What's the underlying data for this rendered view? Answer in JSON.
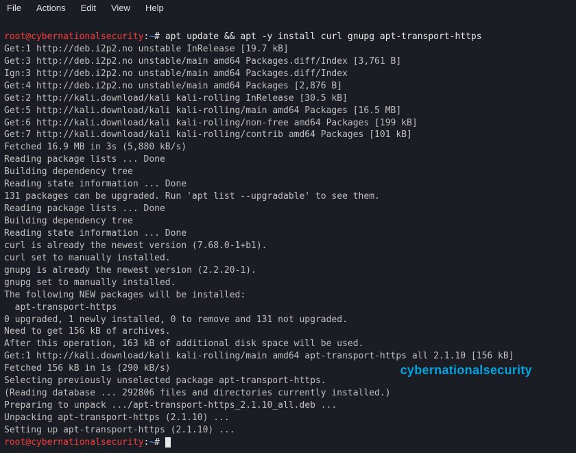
{
  "menubar": {
    "file": "File",
    "actions": "Actions",
    "edit": "Edit",
    "view": "View",
    "help": "Help"
  },
  "prompt": {
    "user_host": "root@cybernationalsecurity",
    "sep": ":",
    "path": "~",
    "symbol": "#"
  },
  "command": "apt update && apt -y install curl gnupg apt-transport-https",
  "output": [
    "Get:1 http://deb.i2p2.no unstable InRelease [19.7 kB]",
    "Get:3 http://deb.i2p2.no unstable/main amd64 Packages.diff/Index [3,761 B]",
    "Ign:3 http://deb.i2p2.no unstable/main amd64 Packages.diff/Index",
    "Get:4 http://deb.i2p2.no unstable/main amd64 Packages [2,876 B]",
    "Get:2 http://kali.download/kali kali-rolling InRelease [30.5 kB]",
    "Get:5 http://kali.download/kali kali-rolling/main amd64 Packages [16.5 MB]",
    "Get:6 http://kali.download/kali kali-rolling/non-free amd64 Packages [199 kB]",
    "Get:7 http://kali.download/kali kali-rolling/contrib amd64 Packages [101 kB]",
    "Fetched 16.9 MB in 3s (5,880 kB/s)",
    "Reading package lists ... Done",
    "Building dependency tree",
    "Reading state information ... Done",
    "131 packages can be upgraded. Run 'apt list --upgradable' to see them.",
    "Reading package lists ... Done",
    "Building dependency tree",
    "Reading state information ... Done",
    "curl is already the newest version (7.68.0-1+b1).",
    "curl set to manually installed.",
    "gnupg is already the newest version (2.2.20-1).",
    "gnupg set to manually installed.",
    "The following NEW packages will be installed:",
    "  apt-transport-https",
    "0 upgraded, 1 newly installed, 0 to remove and 131 not upgraded.",
    "Need to get 156 kB of archives.",
    "After this operation, 163 kB of additional disk space will be used.",
    "Get:1 http://kali.download/kali kali-rolling/main amd64 apt-transport-https all 2.1.10 [156 kB]",
    "Fetched 156 kB in 1s (290 kB/s)",
    "Selecting previously unselected package apt-transport-https.",
    "(Reading database ... 292806 files and directories currently installed.)",
    "Preparing to unpack .../apt-transport-https_2.1.10_all.deb ...",
    "Unpacking apt-transport-https (2.1.10) ...",
    "Setting up apt-transport-https (2.1.10) ..."
  ],
  "watermark": "cybernationalsecurity"
}
